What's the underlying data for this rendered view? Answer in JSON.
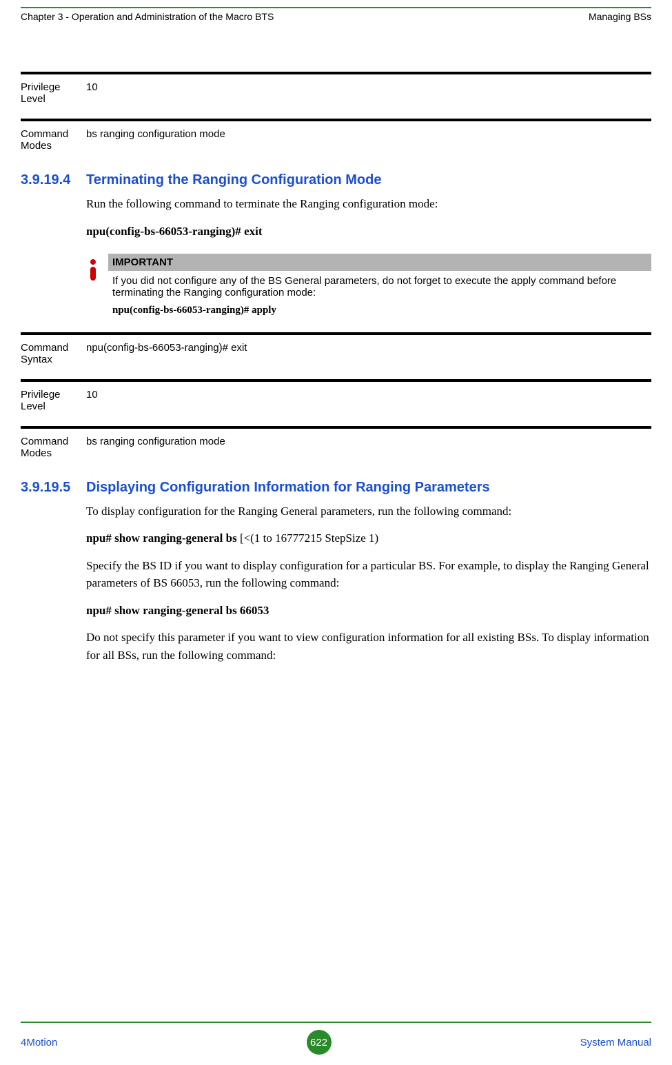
{
  "header": {
    "left": "Chapter 3 - Operation and Administration of the Macro BTS",
    "right": "Managing BSs"
  },
  "top_props": [
    {
      "label": "Privilege Level",
      "value": "10"
    },
    {
      "label": "Command Modes",
      "value": "bs ranging configuration mode"
    }
  ],
  "section1": {
    "number": "3.9.19.4",
    "title": "Terminating the Ranging Configuration Mode",
    "intro": "Run the following command to terminate the Ranging configuration mode:",
    "command_prefix": "npu(config-bs-66053-ranging)# ",
    "command_cmd": "exit"
  },
  "important": {
    "heading": "IMPORTANT",
    "text": "If you did not configure any of the BS General parameters, do not forget to execute the apply command before terminating the Ranging configuration mode:",
    "code": "npu(config-bs-66053-ranging)# apply"
  },
  "section1_props": [
    {
      "label": "Command Syntax",
      "value": "npu(config-bs-66053-ranging)# exit"
    },
    {
      "label": "Privilege Level",
      "value": "10"
    },
    {
      "label": "Command Modes",
      "value": "bs ranging configuration mode"
    }
  ],
  "section2": {
    "number": "3.9.19.5",
    "title": "Displaying Configuration Information for Ranging Parameters",
    "p1": "To display configuration for the Ranging General parameters, run the following command:",
    "cmd1_bold": "npu# show ranging-general bs",
    "cmd1_rest": " [<(1 to 16777215 StepSize 1)",
    "p2": "Specify the BS ID if you want to display configuration for a particular BS. For example, to display the Ranging General parameters of BS 66053, run the following command:",
    "cmd2": "npu# show ranging-general bs 66053",
    "p3": "Do not specify this parameter if you want to view configuration information for all existing BSs. To display information for all BSs, run the following command:"
  },
  "footer": {
    "left": "4Motion",
    "page": "622",
    "right": "System Manual"
  }
}
